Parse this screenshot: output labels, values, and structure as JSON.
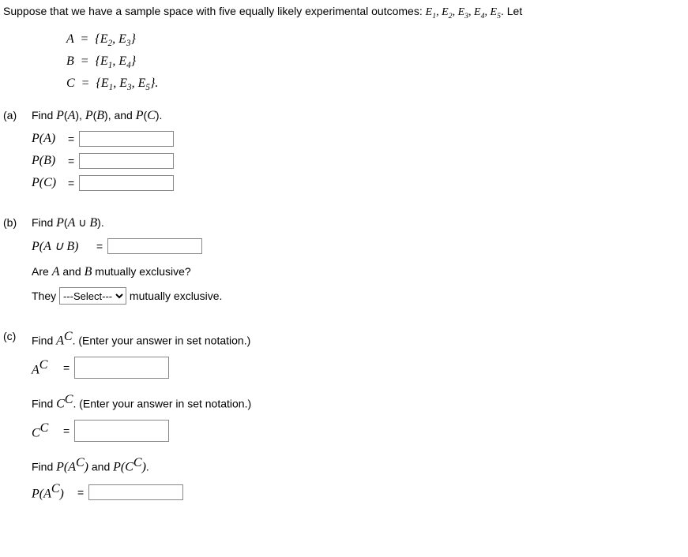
{
  "intro": {
    "prefix": "Suppose that we have a sample space with five equally likely experimental outcomes: ",
    "outcomes_html": "E₁, E₂, E₃, E₄, E₅",
    "suffix": ". Let"
  },
  "sets": {
    "A_lhs": "A",
    "A_rhs": "{E₂, E₃}",
    "B_lhs": "B",
    "B_rhs": "{E₁, E₄}",
    "C_lhs": "C",
    "C_rhs": "{E₁, E₃, E₅}."
  },
  "parts": {
    "a": {
      "marker": "(a)",
      "prompt_html": "Find P(A), P(B), and P(C).",
      "PA": "P(A)",
      "PB": "P(B)",
      "PC": "P(C)"
    },
    "b": {
      "marker": "(b)",
      "prompt1": "Find P(A ∪ B).",
      "label1": "P(A ∪ B)",
      "prompt2": "Are A and B mutually exclusive?",
      "they": "They",
      "select_placeholder": "---Select---",
      "after": "mutually exclusive."
    },
    "c": {
      "marker": "(c)",
      "prompt1_pre": "Find ",
      "Ac": "A",
      "Ac_sup": "C",
      "prompt1_post": ". (Enter your answer in set notation.)",
      "label_Ac": "A",
      "prompt2_pre": "Find ",
      "Cc": "C",
      "Cc_sup": "C",
      "prompt2_post": ". (Enter your answer in set notation.)",
      "label_Cc": "C",
      "prompt3_pre": "Find ",
      "prompt3_mid": " and ",
      "prompt3_post": ".",
      "PAc_pre": "P(A",
      "PCc_pre": "P(C",
      "paren_close": ")"
    }
  },
  "eq": "="
}
